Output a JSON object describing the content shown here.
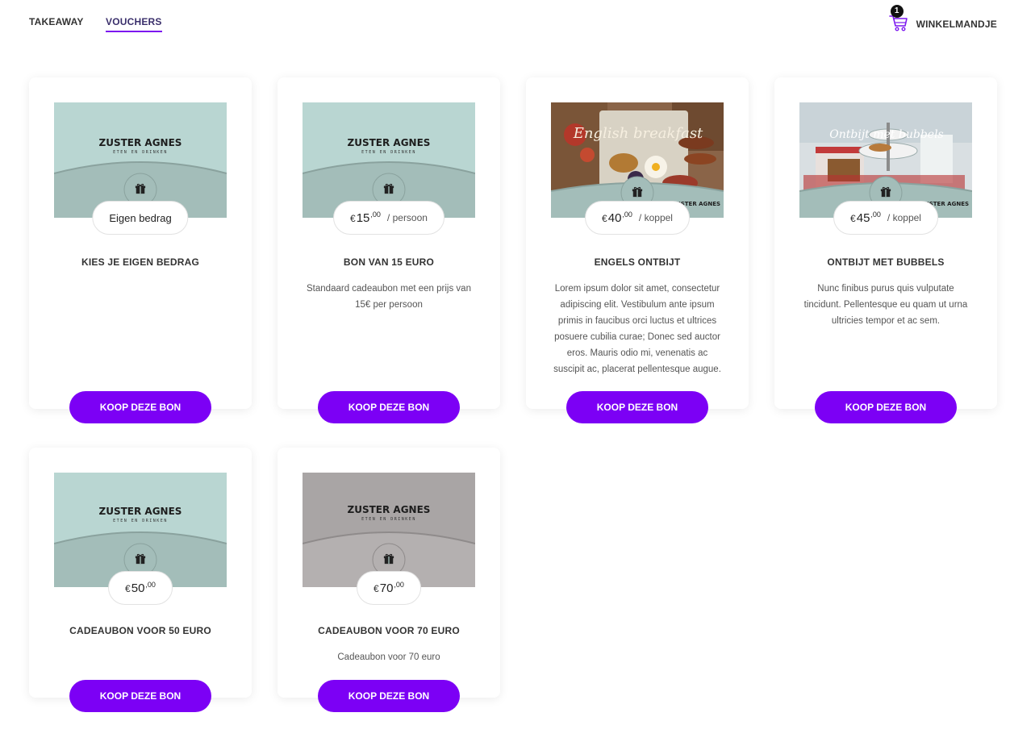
{
  "nav": {
    "takeaway": "TAKEAWAY",
    "vouchers": "VOUCHERS",
    "active": "vouchers"
  },
  "cart": {
    "count": "1",
    "label": "WINKELMANDJE",
    "icon": "cart-icon"
  },
  "colors": {
    "accent": "#7c00f5",
    "voucher_mint": "#b9d6d2",
    "voucher_grey": "#a9a5a5"
  },
  "brand_logo_text": "ZUSTER AGNES",
  "brand_logo_sub": "ETEN EN DRINKEN",
  "vouchers": [
    {
      "image": "brand-mint",
      "price_text": "Eigen bedrag",
      "title": "KIES JE EIGEN BEDRAG",
      "description": "",
      "button": "KOOP DEZE BON"
    },
    {
      "image": "brand-mint",
      "currency": "€",
      "price": "15",
      "cents": ",00",
      "unit": "/ persoon",
      "title": "BON VAN 15 EURO",
      "description": "Standaard cadeaubon met een prijs van 15€ per persoon",
      "button": "KOOP DEZE BON"
    },
    {
      "image": "english-breakfast-photo",
      "image_caption": "English breakfast",
      "currency": "€",
      "price": "40",
      "cents": ",00",
      "unit": "/ koppel",
      "title": "ENGELS ONTBIJT",
      "description": "Lorem ipsum dolor sit amet, consectetur adipiscing elit. Vestibulum ante ipsum primis in faucibus orci luctus et ultrices posuere cubilia curae; Donec sed auctor eros. Mauris odio mi, venenatis ac suscipit ac, placerat pellentesque augue.",
      "button": "KOOP DEZE BON"
    },
    {
      "image": "breakfast-bubbles-photo",
      "image_caption": "Ontbijt met bubbels",
      "currency": "€",
      "price": "45",
      "cents": ",00",
      "unit": "/ koppel",
      "title": "ONTBIJT MET BUBBELS",
      "description": "Nunc finibus purus quis vulputate tincidunt. Pellentesque eu quam ut urna ultricies tempor et ac sem.",
      "button": "KOOP DEZE BON"
    },
    {
      "image": "brand-mint",
      "currency": "€",
      "price": "50",
      "cents": ",00",
      "title": "CADEAUBON VOOR 50 EURO",
      "description": "",
      "button": "KOOP DEZE BON"
    },
    {
      "image": "brand-grey",
      "currency": "€",
      "price": "70",
      "cents": ",00",
      "title": "CADEAUBON VOOR 70 EURO",
      "description": "Cadeaubon voor 70 euro",
      "button": "KOOP DEZE BON"
    }
  ]
}
